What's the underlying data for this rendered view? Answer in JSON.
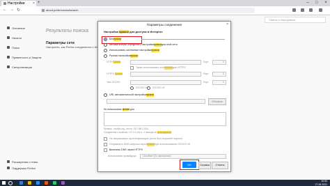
{
  "browser": {
    "tab_title": "Настройки",
    "tab_close": "×",
    "new_tab": "+",
    "address": "about:preferences#search",
    "find_placeholder": "Найти в Настройках",
    "controls": {
      "min": "–",
      "max": "□",
      "close": "×"
    },
    "nav": {
      "back": "←",
      "forward": "→",
      "reload": "↻"
    }
  },
  "sidebar": {
    "items": [
      {
        "label": "Основные",
        "icon": "gear-icon"
      },
      {
        "label": "Начало",
        "icon": "home-icon"
      },
      {
        "label": "Поиск",
        "icon": "search-icon"
      },
      {
        "label": "Приватность и Защита",
        "icon": "lock-icon"
      },
      {
        "label": "Синхронизация",
        "icon": "sync-icon"
      }
    ],
    "bottom": [
      {
        "label": "Расширения и темы",
        "icon": "puzzle-icon"
      },
      {
        "label": "Поддержка Firefox",
        "icon": "help-icon"
      }
    ]
  },
  "background": {
    "title": "Результаты поиска",
    "section": "Параметры сети",
    "desc": "Настроить, как Firefox соединяется с Интернетом."
  },
  "dialog": {
    "title": "Параметры соединения",
    "close": "×",
    "header_pre": "Настройка ",
    "header_hl": "прокси",
    "header_post": " для доступа в Интернет",
    "options": {
      "no_proxy_pre": "Без ",
      "no_proxy_hl": "прокси",
      "autodetect": "Автоматически определять настройки ",
      "autodetect_hl": "прокси",
      "autodetect_post": " для этой сети",
      "system": "Использовать системные настройки ",
      "system_hl": "прокси",
      "manual": "Ручная настройка ",
      "manual_hl": "прокси",
      "auto_url": "URL автоматической настройки ",
      "auto_url_hl": "прокси"
    },
    "fields": {
      "http_lbl": "HTTP ",
      "http_hl": "Прокси",
      "port": "Порт",
      "port_val": "0",
      "also_https_pre": "Также использовать этот ",
      "also_https_hl": "прокси",
      "also_https_post": " для HTTPS",
      "https_lbl": "HTTPS ",
      "https_hl": "Прокси",
      "socks_lbl": "Узел SOCKS",
      "socks_v4": "SOCKS v4",
      "socks_v5": "SOCKS v5",
      "reload_btn": "Обновить"
    },
    "no_proxy_for_pre": "Не использовать ",
    "no_proxy_for_hl": "прокси",
    "no_proxy_for_post": " для",
    "example": "Пример: .mozilla.org, .net.nz, 192.168.1.0/24",
    "local_note_pre": "Соединения с localhost, 127.0.0.1/8 и ::1 никогда не ",
    "local_note_hl": "проксируются",
    "checks": [
      {
        "pre": "Не запрашивать аутентификацию (если был сохранён пароль)",
        "hl": ""
      },
      {
        "pre": "Отправлять DNS-запросы через ",
        "hl": "прокси",
        "post": " при использовании SOCKS v5"
      },
      {
        "pre": "Включить DNS через HTTPS",
        "hl": ""
      }
    ],
    "provider_lbl": "Использовать провайдера",
    "provider_val": "Cloudflare (По умолчанию)",
    "ok": "OK",
    "cancel": "Отмена",
    "help": "Справка"
  },
  "taskbar": {
    "time": "10:53",
    "date": "27.08.2021"
  }
}
